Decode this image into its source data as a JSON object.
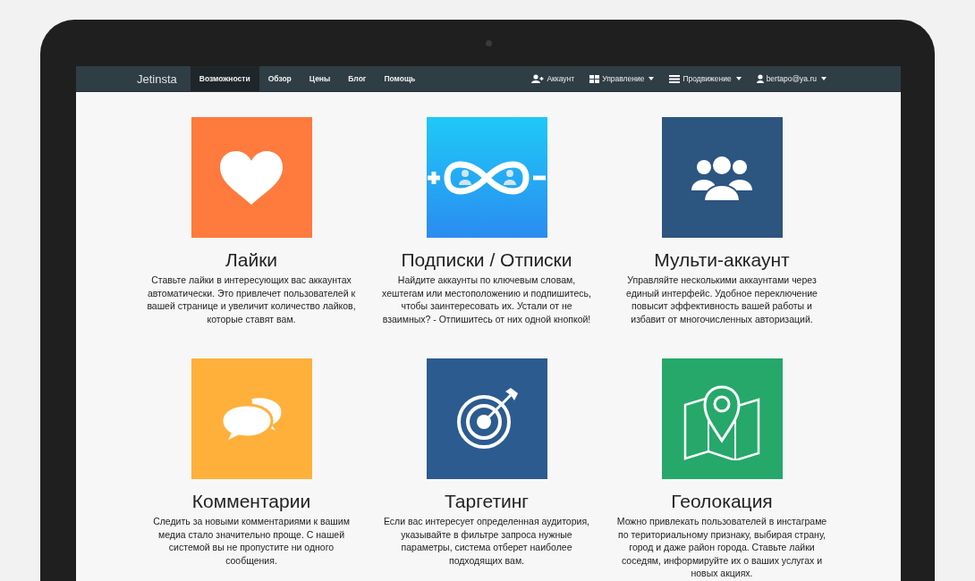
{
  "navbar": {
    "brand": "Jetinsta",
    "left_items": [
      {
        "label": "Возможности",
        "selected": true
      },
      {
        "label": "Обзор",
        "selected": false
      },
      {
        "label": "Цены",
        "selected": false
      },
      {
        "label": "Блог",
        "selected": false
      },
      {
        "label": "Помощь",
        "selected": false
      }
    ],
    "right_items": [
      {
        "label": "Аккаунт",
        "kind": "user-add",
        "dropdown": false
      },
      {
        "label": "Управление",
        "kind": "grid",
        "dropdown": true
      },
      {
        "label": "Продвижение",
        "kind": "list",
        "dropdown": true
      },
      {
        "label": "bertapo@ya.ru",
        "kind": "user",
        "dropdown": true
      }
    ]
  },
  "features": [
    {
      "kind": "heart",
      "color": "#ff7a3d",
      "title": "Лайки",
      "description": "Ставьте лайки в интересующих вас аккаунтах автоматически. Это привлечет пользователей к вашей странице и увеличит количество лайков, которые ставят вам."
    },
    {
      "kind": "infinity",
      "color": "#2a8cf0",
      "title": "Подписки / Отписки",
      "description": "Найдите аккаунты по ключевым словам, хештегам или местоположению и подпишитесь, чтобы заинтересовать их. Устали от не взаимных? - Отпишитесь от них одной кнопкой!"
    },
    {
      "kind": "people",
      "color": "#2c5580",
      "title": "Мульти-аккаунт",
      "description": "Управляйте несколькими аккаунтами через единый интерфейс. Удобное переключение повысит эффективность вашей работы и избавит от многочисленных авторизаций."
    },
    {
      "kind": "chat",
      "color": "#ffb03b",
      "title": "Комментарии",
      "description": "Следить за новыми комментариями к вашим медиа стало значительно проще. С нашей системой вы не пропустите ни одного сообщения."
    },
    {
      "kind": "target",
      "color": "#2c5b8f",
      "title": "Таргетинг",
      "description": "Если вас интересует определенная аудитория, указывайте в фильтре запроса нужные параметры, система отберет наиболее подходящих вам."
    },
    {
      "kind": "map",
      "color": "#25a86a",
      "title": "Геолокация",
      "description": "Можно привлекать пользователей в инстаграме по териториальному признаку, выбирая страну, город и даже район города. Ставьте лайки соседям, информируйте их о ваших услугах и новых акциях."
    }
  ]
}
